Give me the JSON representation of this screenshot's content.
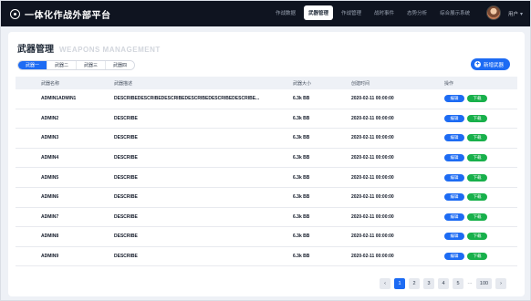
{
  "app": {
    "title": "一体化作战外部平台",
    "nav": [
      "作战数据",
      "武器管理",
      "作战管理",
      "战时事件",
      "态势分析",
      "综合展示系统"
    ],
    "active_nav": 1,
    "user": "用户"
  },
  "page": {
    "title_cn": "武器管理",
    "title_en": "WEAPONS MANAGEMENT",
    "tabs": [
      "武器一",
      "武器二",
      "武器三",
      "武器四"
    ],
    "active_tab": 0,
    "new_button": "新增武器"
  },
  "table": {
    "headers": [
      "武器名称",
      "武器描述",
      "武器大小",
      "创建时间",
      "操作"
    ],
    "rows": [
      [
        "ADMIN1ADMIN1",
        "DESCRIBEDESCRIBEDESCRIBEDESCRIBEDESCRIBEDESCRIBE...",
        "6.3k BB",
        "2020-02-11 00:00:00"
      ],
      [
        "ADMIN2",
        "DESCRIBE",
        "6.3k BB",
        "2020-02-11 00:00:00"
      ],
      [
        "ADMIN3",
        "DESCRIBE",
        "6.3k BB",
        "2020-02-11 00:00:00"
      ],
      [
        "ADMIN4",
        "DESCRIBE",
        "6.3k BB",
        "2020-02-11 00:00:00"
      ],
      [
        "ADMIN5",
        "DESCRIBE",
        "6.3k BB",
        "2020-02-11 00:00:00"
      ],
      [
        "ADMIN6",
        "DESCRIBE",
        "6.3k BB",
        "2020-02-11 00:00:00"
      ],
      [
        "ADMIN7",
        "DESCRIBE",
        "6.3k BB",
        "2020-02-11 00:00:00"
      ],
      [
        "ADMIN8",
        "DESCRIBE",
        "6.3k BB",
        "2020-02-11 00:00:00"
      ],
      [
        "ADMIN9",
        "DESCRIBE",
        "6.3k BB",
        "2020-02-11 00:00:00"
      ]
    ],
    "edit_label": "编辑",
    "download_label": "下载"
  },
  "pagination": {
    "prev": "‹",
    "pages": [
      "1",
      "2",
      "3",
      "4",
      "5"
    ],
    "dots": "···",
    "last": "100",
    "next": "›",
    "current": "1"
  },
  "colors": {
    "accent": "#1d6bf3",
    "success": "#18b04b",
    "nav_bg": "#0f1420"
  }
}
